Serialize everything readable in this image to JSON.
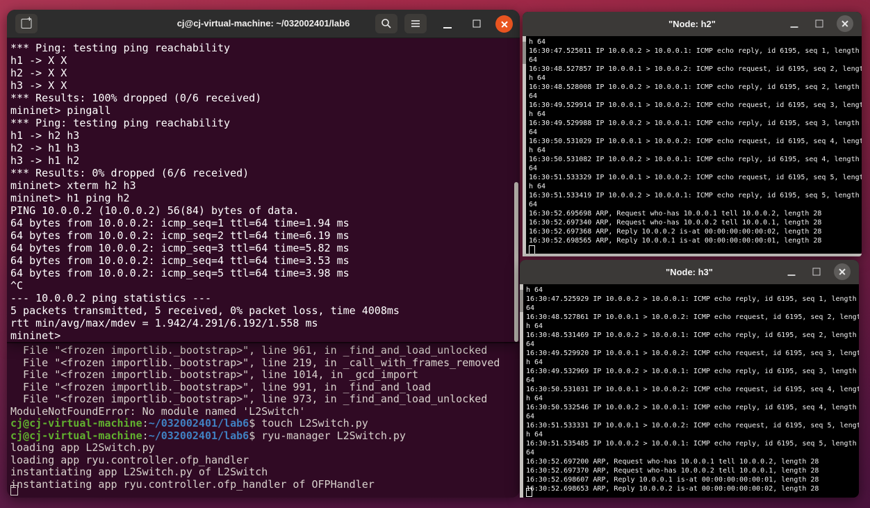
{
  "colors": {
    "accent_close": "#e95420",
    "terminal_bg": "#300a24",
    "main_fg": "#ffffff",
    "ryu_fg": "#d8d2cd",
    "prompt_green": "#61b22f",
    "prompt_blue": "#4081c2",
    "xterm_fg": "#f2f2f2",
    "titlebar_main": "#2d2d2d",
    "titlebar_xterm": "#3b3937",
    "desktop_top": "#a32a49",
    "desktop_bottom": "#43103f"
  },
  "icons": {
    "new_tab": "tab-with-plus",
    "search": "magnifier",
    "menu": "hamburger-lines",
    "minimize": "dash",
    "maximize": "square-outline",
    "close": "x-in-circle"
  },
  "main_window": {
    "title": "cj@cj-virtual-machine: ~/032002401/lab6",
    "lines": [
      "*** Ping: testing ping reachability",
      "h1 -> X X ",
      "h2 -> X X ",
      "h3 -> X X ",
      "*** Results: 100% dropped (0/6 received)",
      "mininet> pingall",
      "*** Ping: testing ping reachability",
      "h1 -> h2 h3 ",
      "h2 -> h1 h3 ",
      "h3 -> h1 h2 ",
      "*** Results: 0% dropped (6/6 received)",
      "mininet> xterm h2 h3",
      "mininet> h1 ping h2",
      "PING 10.0.0.2 (10.0.0.2) 56(84) bytes of data.",
      "64 bytes from 10.0.0.2: icmp_seq=1 ttl=64 time=1.94 ms",
      "64 bytes from 10.0.0.2: icmp_seq=2 ttl=64 time=6.19 ms",
      "64 bytes from 10.0.0.2: icmp_seq=3 ttl=64 time=5.82 ms",
      "64 bytes from 10.0.0.2: icmp_seq=4 ttl=64 time=3.53 ms",
      "64 bytes from 10.0.0.2: icmp_seq=5 ttl=64 time=3.98 ms",
      "^C",
      "--- 10.0.0.2 ping statistics ---",
      "5 packets transmitted, 5 received, 0% packet loss, time 4008ms",
      "rtt min/avg/max/mdev = 1.942/4.291/6.192/1.558 ms",
      "mininet> "
    ]
  },
  "ryu_window": {
    "lines": [
      "  File \"<frozen importlib._bootstrap>\", line 961, in _find_and_load_unlocked",
      "  File \"<frozen importlib._bootstrap>\", line 219, in _call_with_frames_removed",
      "  File \"<frozen importlib._bootstrap>\", line 1014, in _gcd_import",
      "  File \"<frozen importlib._bootstrap>\", line 991, in _find_and_load",
      "  File \"<frozen importlib._bootstrap>\", line 973, in _find_and_load_unlocked",
      "ModuleNotFoundError: No module named 'L2Switch'",
      {
        "spans": [
          [
            "cj@cj-virtual-machine",
            "green"
          ],
          [
            ":",
            ""
          ],
          [
            "~/032002401/lab6",
            "blue"
          ],
          [
            "$ touch L2Switch.py",
            ""
          ]
        ]
      },
      {
        "spans": [
          [
            "cj@cj-virtual-machine",
            "green"
          ],
          [
            ":",
            ""
          ],
          [
            "~/032002401/lab6",
            "blue"
          ],
          [
            "$ ryu-manager L2Switch.py",
            ""
          ]
        ]
      },
      "loading app L2Switch.py",
      "loading app ryu.controller.ofp_handler",
      "instantiating app L2Switch.py of L2Switch",
      "instantiating app ryu.controller.ofp_handler of OFPHandler"
    ]
  },
  "xterm_windows": [
    {
      "id": "h2",
      "title": "\"Node: h2\"",
      "lines": [
        "h 64",
        "16:30:47.525011 IP 10.0.0.2 > 10.0.0.1: ICMP echo reply, id 6195, seq 1, length",
        "64",
        "16:30:48.527857 IP 10.0.0.1 > 10.0.0.2: ICMP echo request, id 6195, seq 2, lengt",
        "h 64",
        "16:30:48.528008 IP 10.0.0.2 > 10.0.0.1: ICMP echo reply, id 6195, seq 2, length",
        "64",
        "16:30:49.529914 IP 10.0.0.1 > 10.0.0.2: ICMP echo request, id 6195, seq 3, lengt",
        "h 64",
        "16:30:49.529988 IP 10.0.0.2 > 10.0.0.1: ICMP echo reply, id 6195, seq 3, length",
        "64",
        "16:30:50.531029 IP 10.0.0.1 > 10.0.0.2: ICMP echo request, id 6195, seq 4, lengt",
        "h 64",
        "16:30:50.531082 IP 10.0.0.2 > 10.0.0.1: ICMP echo reply, id 6195, seq 4, length",
        "64",
        "16:30:51.533329 IP 10.0.0.1 > 10.0.0.2: ICMP echo request, id 6195, seq 5, lengt",
        "h 64",
        "16:30:51.533419 IP 10.0.0.2 > 10.0.0.1: ICMP echo reply, id 6195, seq 5, length",
        "64",
        "16:30:52.695698 ARP, Request who-has 10.0.0.1 tell 10.0.0.2, length 28",
        "16:30:52.697340 ARP, Request who-has 10.0.0.2 tell 10.0.0.1, length 28",
        "16:30:52.697368 ARP, Reply 10.0.0.2 is-at 00:00:00:00:00:02, length 28",
        "16:30:52.698565 ARP, Reply 10.0.0.1 is-at 00:00:00:00:00:01, length 28"
      ]
    },
    {
      "id": "h3",
      "title": "\"Node: h3\"",
      "lines": [
        "h 64",
        "16:30:47.525929 IP 10.0.0.2 > 10.0.0.1: ICMP echo reply, id 6195, seq 1, length",
        "64",
        "16:30:48.527861 IP 10.0.0.1 > 10.0.0.2: ICMP echo request, id 6195, seq 2, lengt",
        "h 64",
        "16:30:48.531469 IP 10.0.0.2 > 10.0.0.1: ICMP echo reply, id 6195, seq 2, length",
        "64",
        "16:30:49.529920 IP 10.0.0.1 > 10.0.0.2: ICMP echo request, id 6195, seq 3, lengt",
        "h 64",
        "16:30:49.532969 IP 10.0.0.2 > 10.0.0.1: ICMP echo reply, id 6195, seq 3, length",
        "64",
        "16:30:50.531031 IP 10.0.0.1 > 10.0.0.2: ICMP echo request, id 6195, seq 4, lengt",
        "h 64",
        "16:30:50.532546 IP 10.0.0.2 > 10.0.0.1: ICMP echo reply, id 6195, seq 4, length",
        "64",
        "16:30:51.533331 IP 10.0.0.1 > 10.0.0.2: ICMP echo request, id 6195, seq 5, lengt",
        "h 64",
        "16:30:51.535485 IP 10.0.0.2 > 10.0.0.1: ICMP echo reply, id 6195, seq 5, length",
        "64",
        "16:30:52.697200 ARP, Request who-has 10.0.0.1 tell 10.0.0.2, length 28",
        "16:30:52.697370 ARP, Request who-has 10.0.0.2 tell 10.0.0.1, length 28",
        "16:30:52.698607 ARP, Reply 10.0.0.1 is-at 00:00:00:00:00:01, length 28",
        "16:30:52.698653 ARP, Reply 10.0.0.2 is-at 00:00:00:00:00:02, length 28"
      ]
    }
  ]
}
